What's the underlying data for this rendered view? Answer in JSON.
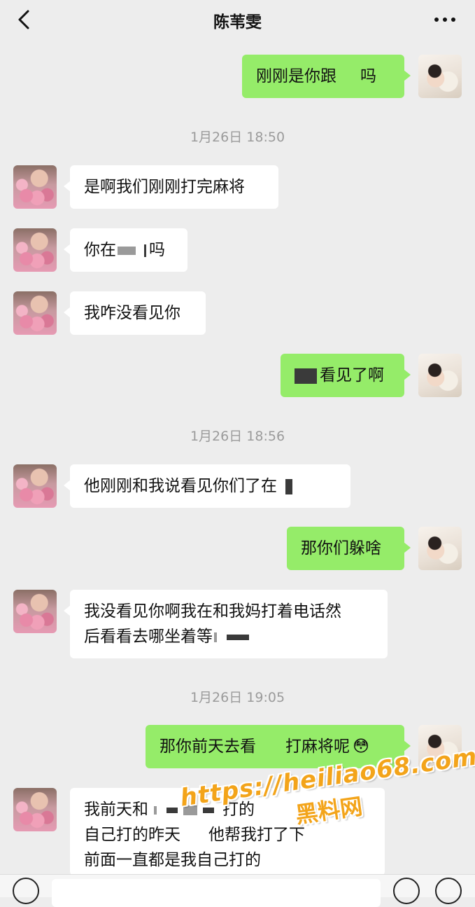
{
  "header": {
    "title": "陈苇雯",
    "back_icon": "chevron-left-icon",
    "more_icon": "more-dots-icon"
  },
  "timestamps": [
    "1月26日 18:50",
    "1月26日 18:56",
    "1月26日 19:05"
  ],
  "messages": [
    {
      "side": "right",
      "parts": [
        "刚刚是你跟",
        "吗"
      ]
    },
    {
      "side": "left",
      "text": "是啊我们刚刚打完麻将"
    },
    {
      "side": "left",
      "parts": [
        "你在",
        "吗"
      ]
    },
    {
      "side": "left",
      "text": "我咋没看见你"
    },
    {
      "side": "right",
      "text": "看见了啊"
    },
    {
      "side": "left",
      "text": "他刚刚和我说看见你们了在"
    },
    {
      "side": "right",
      "text": "那你们躲啥"
    },
    {
      "side": "left",
      "lines": [
        "我没看见你啊我在和我妈打着电话然",
        "后看看去哪坐着等"
      ]
    },
    {
      "side": "right",
      "parts": [
        "那你前天去看",
        "打麻将呢"
      ],
      "emoji": "😳"
    },
    {
      "side": "left",
      "lines": [
        "我前天和",
        "打的",
        "自己打的昨天",
        "他帮我打了下",
        "前面一直都是我自己打的"
      ]
    }
  ],
  "watermark": {
    "url": "https://heiliao68.com",
    "name": "黑料网"
  },
  "colors": {
    "background": "#ededed",
    "bubble_sent": "#95ec69",
    "bubble_received": "#ffffff",
    "timestamp": "#9b9b9b",
    "watermark": "#f3a41a"
  }
}
